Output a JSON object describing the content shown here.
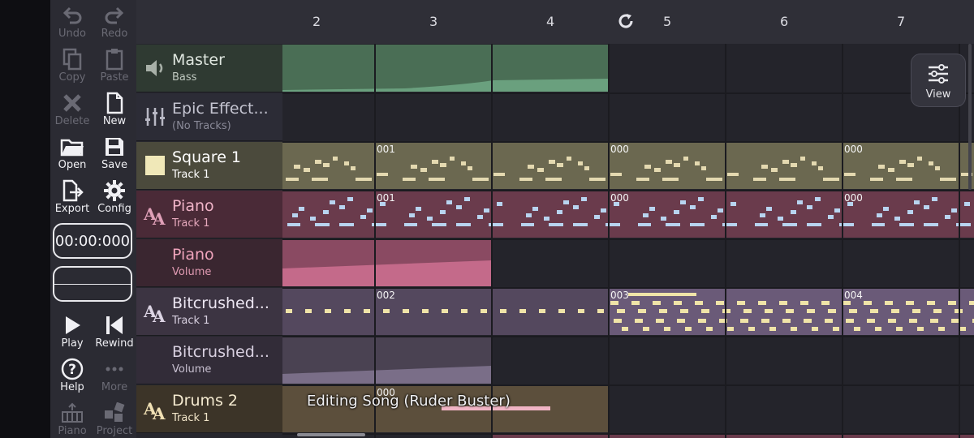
{
  "toolbar": {
    "undo": "Undo",
    "redo": "Redo",
    "copy": "Copy",
    "paste": "Paste",
    "delete": "Delete",
    "new": "New",
    "open": "Open",
    "save": "Save",
    "export": "Export",
    "config": "Config",
    "play": "Play",
    "rewind": "Rewind",
    "help": "Help",
    "more": "More",
    "piano": "Piano",
    "project": "Project"
  },
  "time": "00:00:000",
  "ruler": {
    "measures": [
      "2",
      "3",
      "4",
      "5",
      "6",
      "7"
    ]
  },
  "tracks": [
    {
      "name": "Master",
      "sub": "Bass"
    },
    {
      "name": "Epic Effect...",
      "sub": "(No Tracks)"
    },
    {
      "name": "Square 1",
      "sub": "Track 1"
    },
    {
      "name": "Piano",
      "sub": "Track 1"
    },
    {
      "name": "Piano",
      "sub": "Volume"
    },
    {
      "name": "Bitcrushed...",
      "sub": "Track 1"
    },
    {
      "name": "Bitcrushed...",
      "sub": "Volume"
    },
    {
      "name": "Drums 2",
      "sub": "Track 1"
    }
  ],
  "patterns": {
    "square_a": "001",
    "square_b": "000",
    "square_c": "000",
    "piano_a": "001",
    "piano_b": "000",
    "piano_c": "000",
    "bit_a": "002",
    "bit_b": "003",
    "bit_c": "004",
    "drums_a": "000"
  },
  "view_label": "View",
  "toast": "Editing Song (Ruder Buster)",
  "colors": {
    "master": "#33463a",
    "epic": "#2e2e3a",
    "square": "#6b6850",
    "piano": "#6a3b4c",
    "bit": "#54485e",
    "drums": "#5c4f3c",
    "square_note": "#e4d9b0",
    "piano_note": "#b8d4f0",
    "bit_note": "#f0e4a8"
  }
}
